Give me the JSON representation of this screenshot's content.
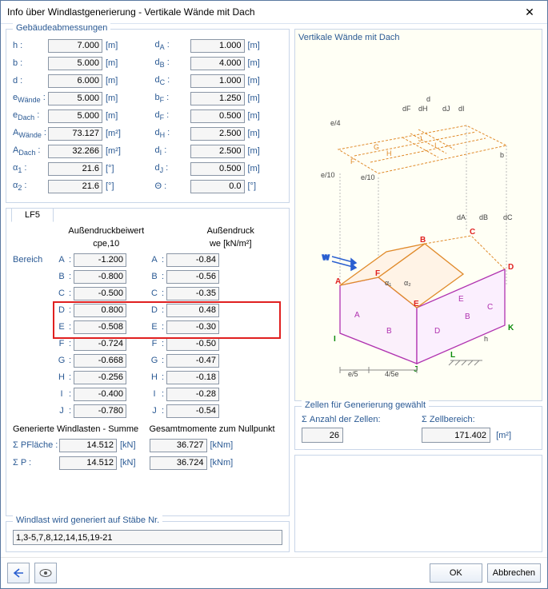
{
  "window": {
    "title": "Info über Windlastgenerierung  -  Vertikale Wände mit Dach"
  },
  "groups": {
    "dims": "Gebäudeabmessungen",
    "staebe": "Windlast wird generiert auf Stäbe Nr.",
    "zellen": "Zellen für Generierung gewählt"
  },
  "dims_left": [
    {
      "label": "h :",
      "value": "7.000",
      "unit": "[m]"
    },
    {
      "label": "b :",
      "value": "5.000",
      "unit": "[m]"
    },
    {
      "label": "d :",
      "value": "6.000",
      "unit": "[m]"
    },
    {
      "label": "eWände :",
      "sub": "Wände",
      "pre": "e",
      "value": "5.000",
      "unit": "[m]"
    },
    {
      "label": "eDach :",
      "sub": "Dach",
      "pre": "e",
      "value": "5.000",
      "unit": "[m]"
    },
    {
      "label": "AWände :",
      "sub": "Wände",
      "pre": "A",
      "value": "73.127",
      "unit": "[m²]"
    },
    {
      "label": "ADach :",
      "sub": "Dach",
      "pre": "A",
      "value": "32.266",
      "unit": "[m²]"
    },
    {
      "label": "α1 :",
      "sub": "1",
      "pre": "α",
      "value": "21.6",
      "unit": "[°]"
    },
    {
      "label": "α2 :",
      "sub": "2",
      "pre": "α",
      "value": "21.6",
      "unit": "[°]"
    }
  ],
  "dims_right": [
    {
      "pre": "d",
      "sub": "A",
      "value": "1.000",
      "unit": "[m]"
    },
    {
      "pre": "d",
      "sub": "B",
      "value": "4.000",
      "unit": "[m]"
    },
    {
      "pre": "d",
      "sub": "C",
      "value": "1.000",
      "unit": "[m]"
    },
    {
      "pre": "b",
      "sub": "F",
      "value": "1.250",
      "unit": "[m]"
    },
    {
      "pre": "d",
      "sub": "F",
      "value": "0.500",
      "unit": "[m]"
    },
    {
      "pre": "d",
      "sub": "H",
      "value": "2.500",
      "unit": "[m]"
    },
    {
      "pre": "d",
      "sub": "I",
      "value": "2.500",
      "unit": "[m]"
    },
    {
      "pre": "d",
      "sub": "J",
      "value": "0.500",
      "unit": "[m]"
    },
    {
      "pre": "Θ",
      "sub": "",
      "value": "0.0",
      "unit": "[°]"
    }
  ],
  "tab": "LF5",
  "table": {
    "head1": "Außendruckbeiwert",
    "head2": "Außendruck",
    "sub1": "cpe,10",
    "sub2": "we [kN/m²]",
    "area_hdr": "Bereich",
    "rows": [
      {
        "k": "A",
        "c": "-1.200",
        "w": "-0.84"
      },
      {
        "k": "B",
        "c": "-0.800",
        "w": "-0.56"
      },
      {
        "k": "C",
        "c": "-0.500",
        "w": "-0.35"
      },
      {
        "k": "D",
        "c": "0.800",
        "w": "0.48",
        "hl": true
      },
      {
        "k": "E",
        "c": "-0.508",
        "w": "-0.30",
        "hl": true
      },
      {
        "k": "F",
        "c": "-0.724",
        "w": "-0.50"
      },
      {
        "k": "G",
        "c": "-0.668",
        "w": "-0.47"
      },
      {
        "k": "H",
        "c": "-0.256",
        "w": "-0.18"
      },
      {
        "k": "I",
        "c": "-0.400",
        "w": "-0.28"
      },
      {
        "k": "J",
        "c": "-0.780",
        "w": "-0.54"
      }
    ]
  },
  "sums": {
    "h1": "Generierte Windlasten - Summe",
    "h2": "Gesamtmomente zum Nullpunkt",
    "rows_left": [
      {
        "l": "Σ PFläche :",
        "sub": "Fläche",
        "pre": "Σ P",
        "v": "14.512",
        "u": "[kN]"
      },
      {
        "l": "Σ P :",
        "v": "14.512",
        "u": "[kN]"
      }
    ],
    "rows_right": [
      {
        "v": "36.727",
        "u": "[kNm]"
      },
      {
        "v": "36.724",
        "u": "[kNm]"
      }
    ]
  },
  "staebe_value": "1,3-5,7,8,12,14,15,19-21",
  "diagram_title": "Vertikale Wände mit Dach",
  "zellen": {
    "l1": "Σ Anzahl der Zellen:",
    "v1": "26",
    "l2": "Σ Zellbereich:",
    "v2": "171.402",
    "u2": "[m²]"
  },
  "buttons": {
    "ok": "OK",
    "cancel": "Abbrechen"
  }
}
